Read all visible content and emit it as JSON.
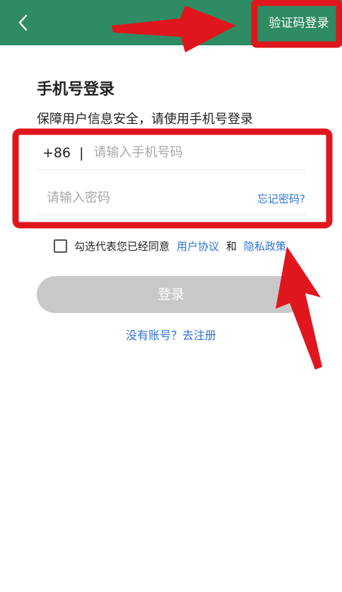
{
  "header": {
    "back_icon": "chevron-left-icon",
    "sms_login_label": "验证码登录",
    "background_color": "#2e8b63"
  },
  "main": {
    "title": "手机号登录",
    "subtitle": "保障用户信息安全，请使用手机号登录",
    "phone": {
      "country_code": "+86",
      "separator": "|",
      "placeholder": "请输入手机号码"
    },
    "password": {
      "placeholder": "请输入密码",
      "forgot_label": "忘记密码?"
    },
    "agreement": {
      "text": "勾选代表您已经同意",
      "user_agreement": "用户协议",
      "and": "和",
      "privacy_policy": "隐私政策",
      "checked": false
    },
    "login_button": "登录",
    "register_link": "没有账号？去注册"
  },
  "colors": {
    "accent": "#2e8b63",
    "link": "#2f73d9",
    "button_disabled": "#c8c8c8",
    "annotation_red": "#e0161e"
  }
}
